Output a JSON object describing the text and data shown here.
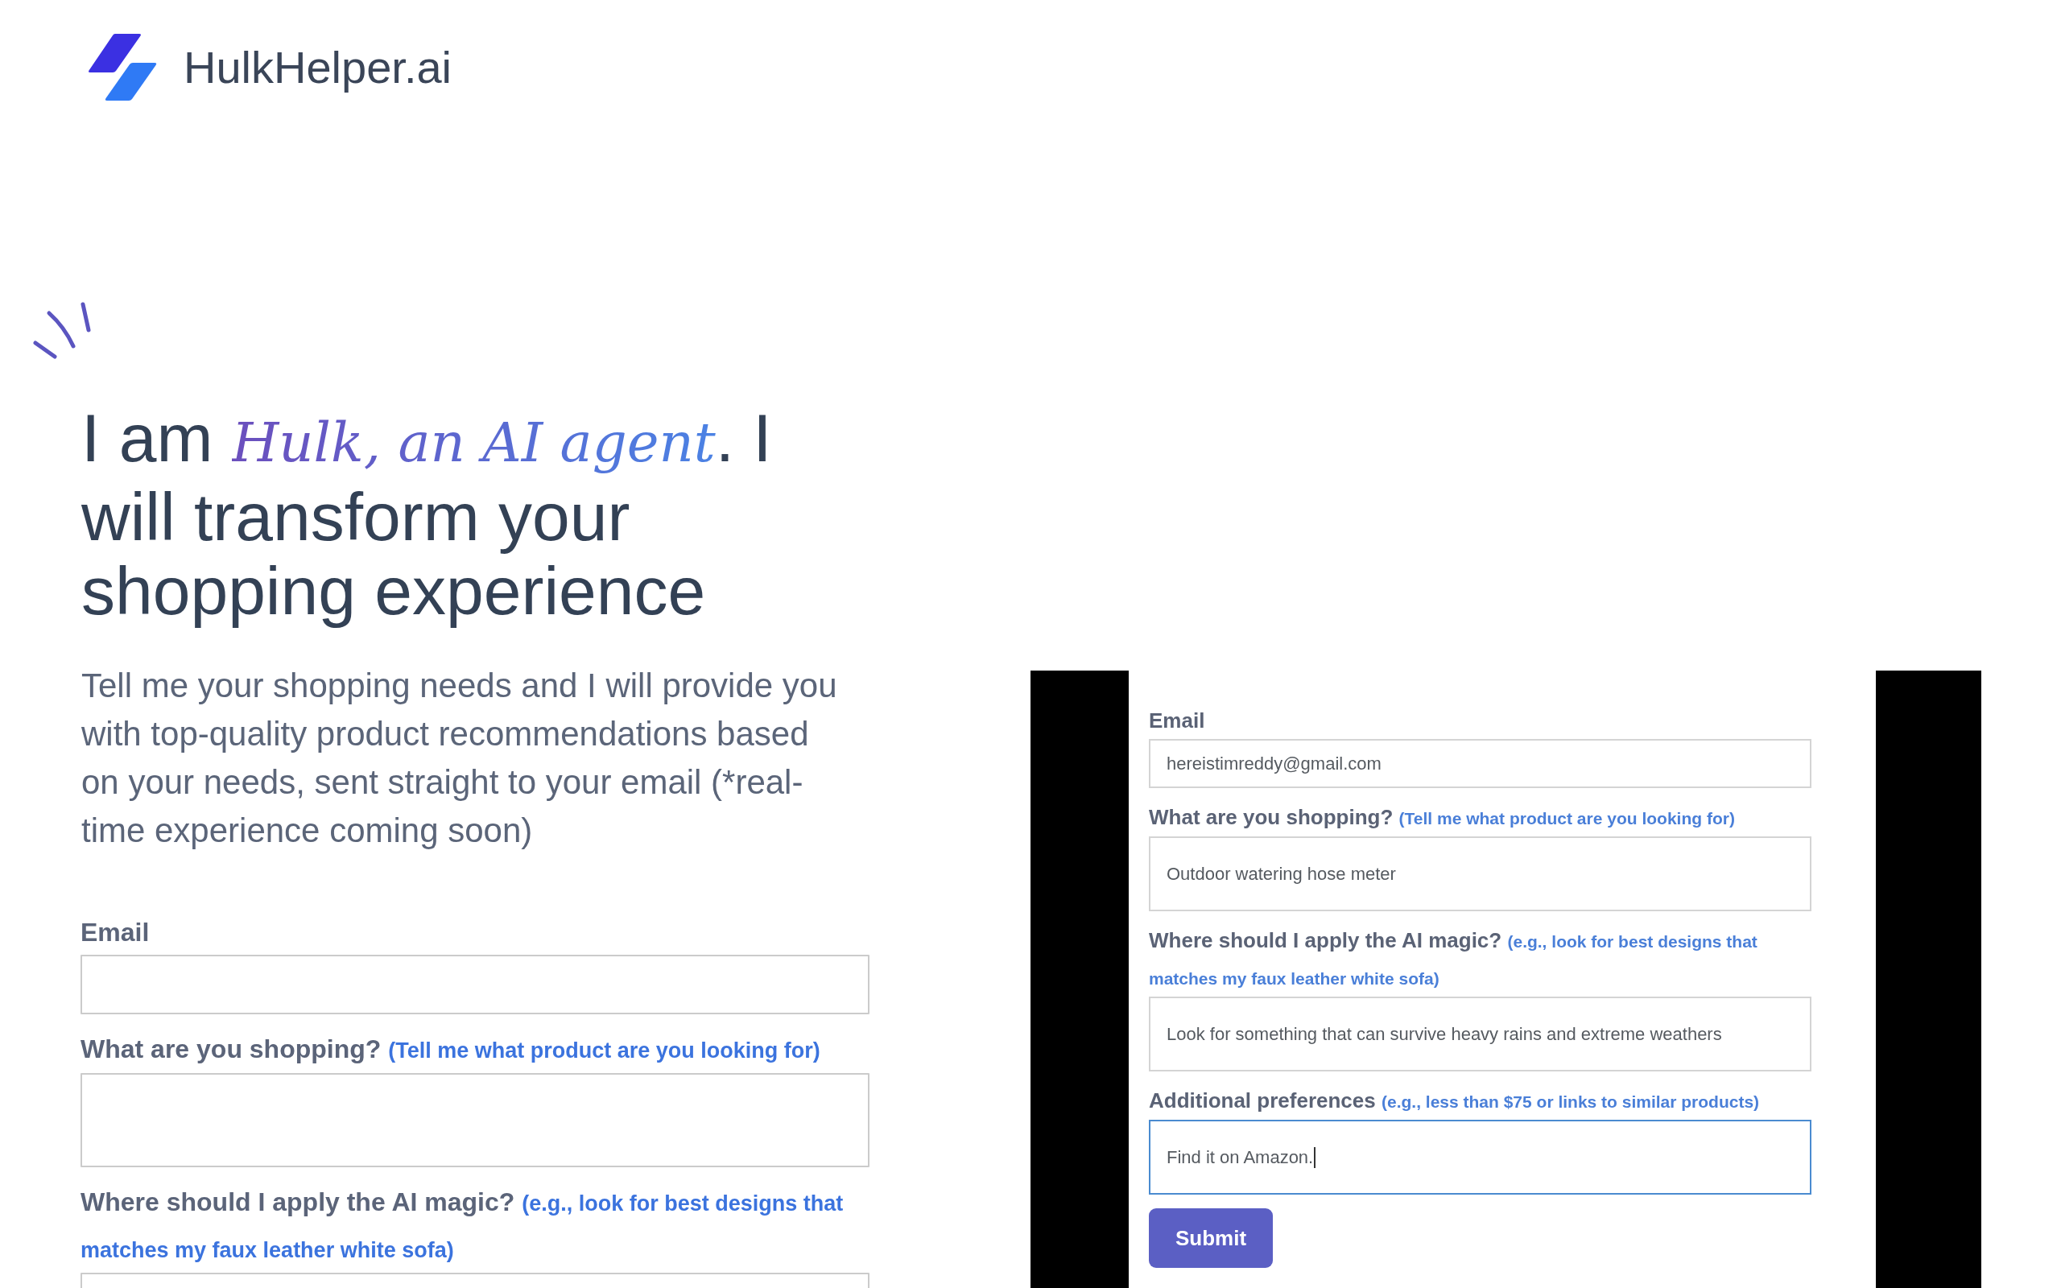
{
  "header": {
    "logo_text": "HulkHelper.ai"
  },
  "hero": {
    "heading": "I am *Hulk, an AI agent*. I will transform your shopping experience",
    "description": "Tell me your shopping needs and I will provide you with top-quality product recommendations based on your needs, sent straight to your email (*real-time experience coming soon)"
  },
  "signup_form": {
    "fields": [
      {
        "kind": "input",
        "label": "Email"
      },
      {
        "kind": "textarea",
        "label": "What are you shopping?",
        "hint": "(Tell me what product are you looking for)"
      },
      {
        "kind": "textarea",
        "label": "Where should I apply the AI magic?",
        "hint": "(e.g., look for best designs that matches my faux leather white sofa)"
      }
    ]
  },
  "demo_video": {
    "fields": [
      {
        "kind": "input",
        "label": "Email",
        "value": "hereistimreddy@gmail.com",
        "focused": false
      },
      {
        "kind": "textarea",
        "label": "What are you shopping?",
        "hint": "(Tell me what product are you looking for)",
        "value": "Outdoor watering hose meter",
        "focused": false
      },
      {
        "kind": "textarea",
        "label": "Where should I apply the AI magic?",
        "hint": "(e.g., look for best designs that matches my faux leather white sofa)",
        "value": "Look for something that can survive heavy rains and extreme weathers",
        "focused": false
      },
      {
        "kind": "textarea",
        "label": "Additional preferences",
        "hint": "(e.g., less than $75 or links to similar products)",
        "value": "Find it on Amazon.",
        "focused": true
      }
    ],
    "submit_button": "Submit"
  }
}
